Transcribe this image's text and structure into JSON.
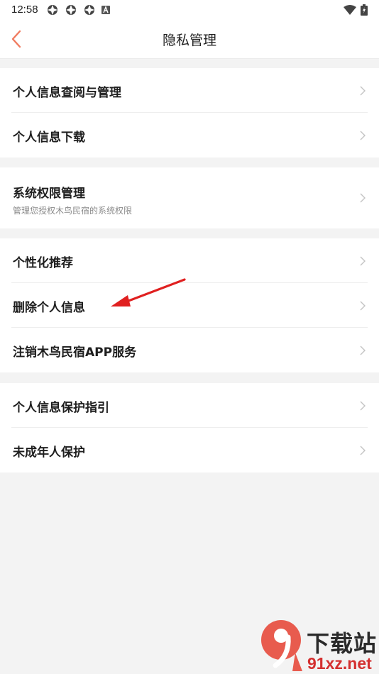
{
  "status_bar": {
    "time": "12:58",
    "icons": [
      "app-notification-icon",
      "app-notification-icon",
      "app-notification-icon",
      "keyboard-a-icon",
      "wifi-icon",
      "battery-charging-icon"
    ]
  },
  "nav": {
    "title": "隐私管理",
    "back_icon": "chevron-left-icon"
  },
  "groups": [
    {
      "items": [
        {
          "label": "个人信息查阅与管理"
        },
        {
          "label": "个人信息下载"
        }
      ]
    },
    {
      "items": [
        {
          "label": "系统权限管理",
          "subtitle": "管理您授权木鸟民宿的系统权限"
        }
      ]
    },
    {
      "items": [
        {
          "label": "个性化推荐"
        },
        {
          "label": "删除个人信息"
        },
        {
          "label": "注销木鸟民宿APP服务"
        }
      ]
    },
    {
      "items": [
        {
          "label": "个人信息保护指引"
        },
        {
          "label": "未成年人保护"
        }
      ]
    }
  ],
  "watermark": {
    "logo_text": "9",
    "line1": "下载站",
    "line2": "91xz.net"
  },
  "colors": {
    "accent": "#f07b5f",
    "background": "#f3f3f3",
    "annotation": "#e02020",
    "watermark_red": "#d43030"
  }
}
